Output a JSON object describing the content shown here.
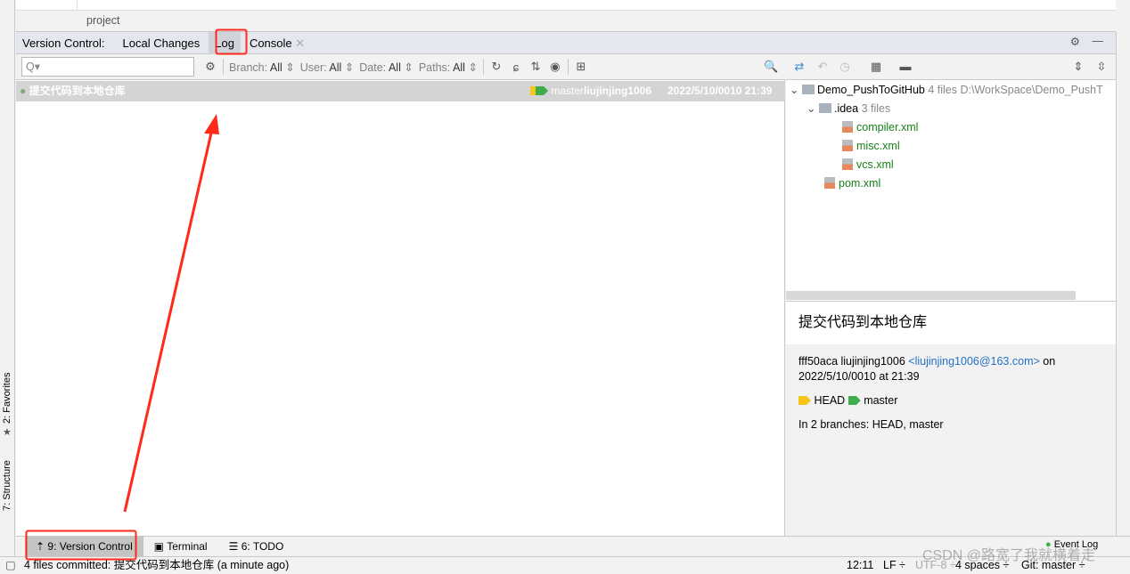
{
  "side_tools": {
    "favorites": "2: Favorites",
    "structure": "7: Structure"
  },
  "project_label": "project",
  "tabs": {
    "prefix": "Version Control:",
    "items": [
      "Local Changes",
      "Log",
      "Console"
    ],
    "selected": "Log"
  },
  "toolbar": {
    "search_placeholder": "Q▾",
    "filters": [
      {
        "label": "Branch:",
        "value": "All"
      },
      {
        "label": "User:",
        "value": "All"
      },
      {
        "label": "Date:",
        "value": "All"
      },
      {
        "label": "Paths:",
        "value": "All"
      }
    ]
  },
  "log": {
    "rows": [
      {
        "message": "提交代码到本地仓库",
        "branch": "master",
        "author": "liujinjing1006",
        "date": "2022/5/10/0010 21:39"
      }
    ]
  },
  "tree": {
    "root": {
      "name": "Demo_PushToGitHub",
      "count": "4 files",
      "path": "D:\\WorkSpace\\Demo_PushT"
    },
    "folder": {
      "name": ".idea",
      "count": "3 files"
    },
    "files": [
      "compiler.xml",
      "misc.xml",
      "vcs.xml"
    ],
    "root_file": "pom.xml"
  },
  "details": {
    "title": "提交代码到本地仓库",
    "hash_author": "fff50aca liujinjing1006",
    "email": "<liujinjing1006@163.com>",
    "on": "on",
    "date": "2022/5/10/0010 at 21:39",
    "tags": [
      "HEAD",
      "master"
    ],
    "branches": "In 2 branches: HEAD, master"
  },
  "bottom_tabs": [
    "9: Version Control",
    "Terminal",
    "6: TODO"
  ],
  "event_log": "Event Log",
  "status": {
    "message": "4 files committed: 提交代码到本地仓库 (a minute ago)",
    "position": "12:11",
    "line_sep": "LF ÷",
    "encoding": "UTF-8 ÷",
    "indent": "4 spaces ÷",
    "git": "Git: master ÷"
  },
  "watermark": "CSDN @路宽了我就横着走",
  "colors": {
    "annotation": "#ff2a1a",
    "tag_head": "#f5c518",
    "tag_master": "#3dae4a",
    "link": "#2470c4"
  }
}
